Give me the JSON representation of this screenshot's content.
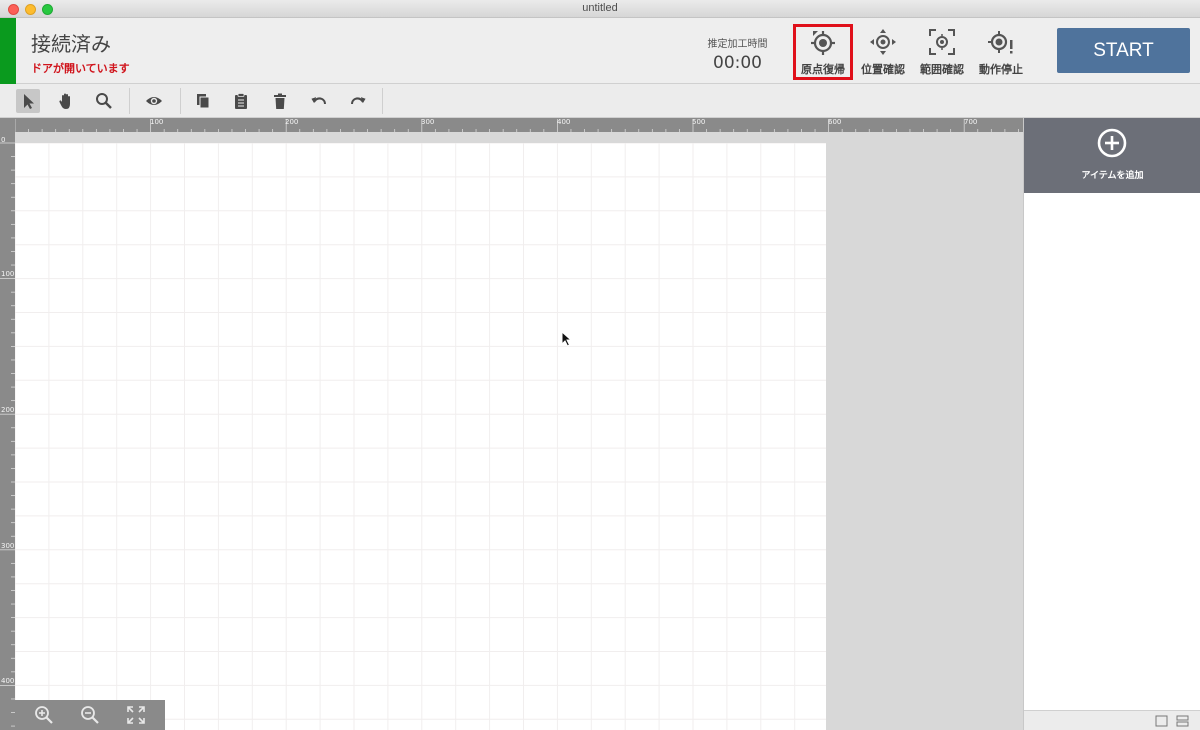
{
  "window": {
    "title": "untitled"
  },
  "header": {
    "connection_status": "接続済み",
    "door_warning": "ドアが開いています",
    "estimated_time_label": "推定加工時間",
    "estimated_time_value": "00:00",
    "buttons": [
      {
        "label": "原点復帰",
        "icon": "home-origin-icon",
        "highlighted": true
      },
      {
        "label": "位置確認",
        "icon": "position-check-icon"
      },
      {
        "label": "範囲確認",
        "icon": "range-check-icon"
      },
      {
        "label": "動作停止",
        "icon": "stop-motion-icon"
      }
    ],
    "start_label": "START",
    "colors": {
      "connected": "#0a9a1e",
      "warning": "#d0141c",
      "start": "#4f739c",
      "highlight": "#e0101a"
    }
  },
  "toolbar": {
    "tools": [
      "select-arrow-icon",
      "hand-pan-icon",
      "zoom-search-icon",
      "eye-preview-icon",
      "copy-icon",
      "paste-clipboard-icon",
      "trash-icon",
      "undo-icon",
      "redo-icon"
    ],
    "active_tool": "select-arrow-icon"
  },
  "rulers": {
    "top_labels": [
      "0",
      "100",
      "200",
      "300",
      "400",
      "500",
      "600",
      "700"
    ],
    "left_labels": [
      "0",
      "100",
      "200",
      "300",
      "400"
    ]
  },
  "zoom_controls": [
    "zoom-in-icon",
    "zoom-out-icon",
    "fit-screen-icon"
  ],
  "right_panel": {
    "add_item_label": "アイテムを追加",
    "view_toggles": [
      "single-view-icon",
      "split-view-icon"
    ]
  }
}
